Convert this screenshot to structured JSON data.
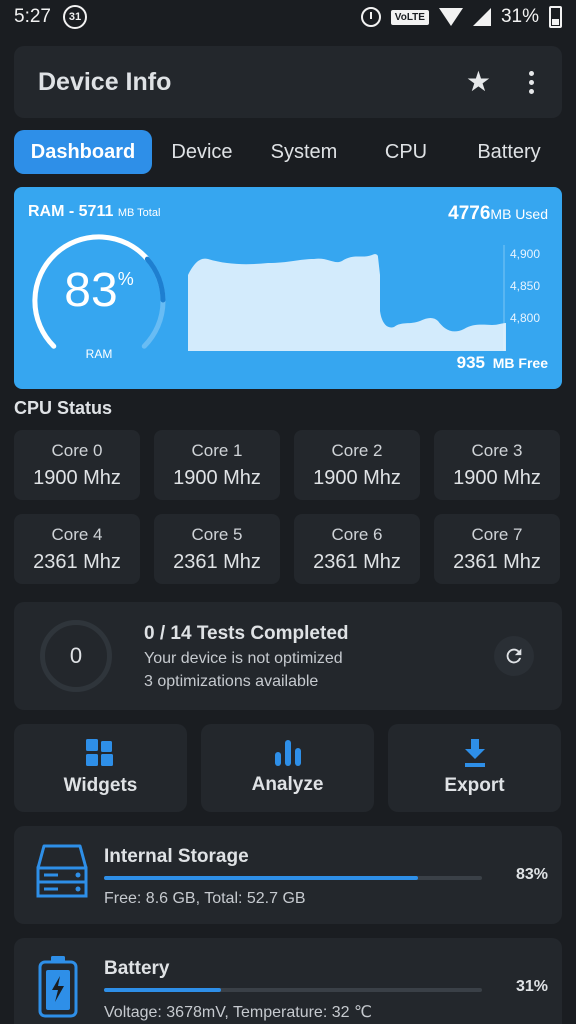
{
  "status_bar": {
    "time": "5:27",
    "calendar_badge": "31",
    "volte": "VoLTE",
    "battery_pct": "31%"
  },
  "app_bar": {
    "title": "Device Info",
    "star_icon": "star-icon",
    "more_icon": "more-vert-icon"
  },
  "tabs": [
    {
      "label": "Dashboard",
      "active": true
    },
    {
      "label": "Device",
      "active": false
    },
    {
      "label": "System",
      "active": false
    },
    {
      "label": "CPU",
      "active": false
    },
    {
      "label": "Battery",
      "active": false
    }
  ],
  "ram": {
    "title": "RAM - 5711",
    "total_suffix": "MB Total",
    "used_value": "4776",
    "used_suffix": "MB Used",
    "free_value": "935",
    "free_suffix": "MB Free",
    "percent": "83",
    "percent_sign": "%",
    "gauge_label": "RAM",
    "gauge_fraction": 0.83,
    "axis_ticks": [
      "4,900",
      "4,850",
      "4,800"
    ],
    "color_card": "#36a6f0"
  },
  "cpu_status": {
    "title": "CPU Status",
    "cores": [
      {
        "name": "Core 0",
        "freq": "1900 Mhz"
      },
      {
        "name": "Core 1",
        "freq": "1900 Mhz"
      },
      {
        "name": "Core 2",
        "freq": "1900 Mhz"
      },
      {
        "name": "Core 3",
        "freq": "1900 Mhz"
      },
      {
        "name": "Core 4",
        "freq": "2361 Mhz"
      },
      {
        "name": "Core 5",
        "freq": "2361 Mhz"
      },
      {
        "name": "Core 6",
        "freq": "2361 Mhz"
      },
      {
        "name": "Core 7",
        "freq": "2361 Mhz"
      }
    ]
  },
  "tests": {
    "ring_value": "0",
    "title": "0  / 14 Tests Completed",
    "line1": "Your device is not optimized",
    "line2": "3 optimizations available",
    "refresh_icon": "refresh-icon"
  },
  "actions": [
    {
      "label": "Widgets",
      "icon": "widgets-icon"
    },
    {
      "label": "Analyze",
      "icon": "bar-chart-icon"
    },
    {
      "label": "Export",
      "icon": "download-icon"
    }
  ],
  "storage": {
    "title": "Internal Storage",
    "percent": "83%",
    "fraction": 0.83,
    "subtitle": "Free: 8.6 GB,  Total: 52.7 GB",
    "icon": "storage-icon"
  },
  "battery": {
    "title": "Battery",
    "percent": "31%",
    "fraction": 0.31,
    "subtitle": "Voltage: 3678mV,  Temperature: 32 ℃",
    "icon": "battery-icon"
  },
  "colors": {
    "accent": "#2e8fe8",
    "background": "#1a1d21",
    "card": "#23272c"
  }
}
